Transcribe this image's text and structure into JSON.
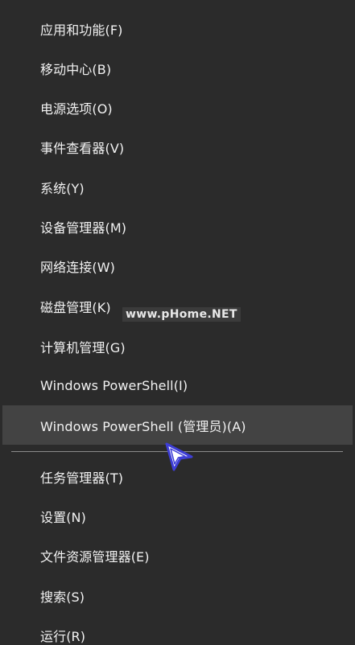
{
  "menu": {
    "items": [
      {
        "label": "应用和功能(F)"
      },
      {
        "label": "移动中心(B)"
      },
      {
        "label": "电源选项(O)"
      },
      {
        "label": "事件查看器(V)"
      },
      {
        "label": "系统(Y)"
      },
      {
        "label": "设备管理器(M)"
      },
      {
        "label": "网络连接(W)"
      },
      {
        "label": "磁盘管理(K)"
      },
      {
        "label": "计算机管理(G)"
      },
      {
        "label": "Windows PowerShell(I)"
      },
      {
        "label": "Windows PowerShell (管理员)(A)"
      },
      {
        "label": "任务管理器(T)"
      },
      {
        "label": "设置(N)"
      },
      {
        "label": "文件资源管理器(E)"
      },
      {
        "label": "搜索(S)"
      },
      {
        "label": "运行(R)"
      }
    ]
  },
  "watermark": "www.pHome.NET",
  "colors": {
    "background": "#2b2b2b",
    "highlight": "#434343",
    "text": "#f2f2f2",
    "cursor": "#3e3ed6"
  }
}
